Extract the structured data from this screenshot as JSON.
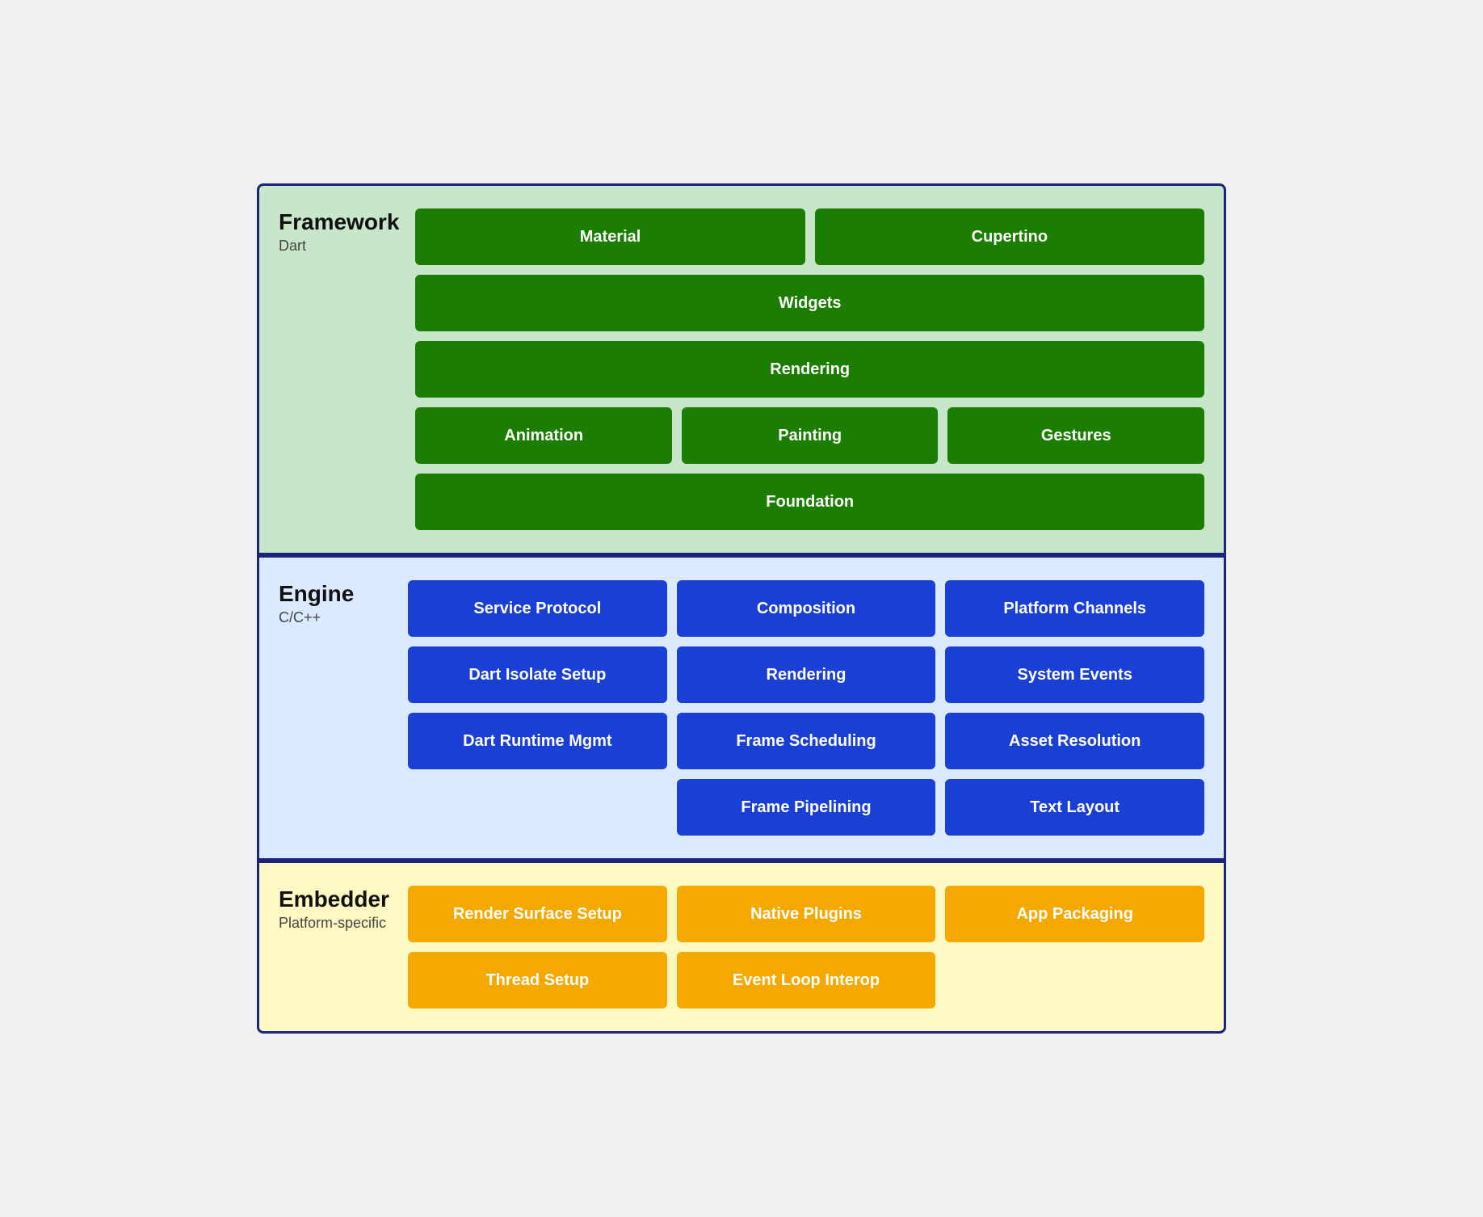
{
  "framework": {
    "title": "Framework",
    "subtitle": "Dart",
    "rows": [
      [
        {
          "label": "Material",
          "span": 1
        },
        {
          "label": "Cupertino",
          "span": 1
        }
      ],
      [
        {
          "label": "Widgets",
          "span": 2
        }
      ],
      [
        {
          "label": "Rendering",
          "span": 2
        }
      ],
      [
        {
          "label": "Animation",
          "span": 1
        },
        {
          "label": "Painting",
          "span": 1
        },
        {
          "label": "Gestures",
          "span": 1
        }
      ],
      [
        {
          "label": "Foundation",
          "span": 3
        }
      ]
    ]
  },
  "engine": {
    "title": "Engine",
    "subtitle": "C/C++",
    "rows": [
      [
        {
          "label": "Service Protocol",
          "span": 1
        },
        {
          "label": "Composition",
          "span": 1
        },
        {
          "label": "Platform Channels",
          "span": 1
        }
      ],
      [
        {
          "label": "Dart Isolate Setup",
          "span": 1
        },
        {
          "label": "Rendering",
          "span": 1
        },
        {
          "label": "System Events",
          "span": 1
        }
      ],
      [
        {
          "label": "Dart Runtime Mgmt",
          "span": 1
        },
        {
          "label": "Frame Scheduling",
          "span": 1
        },
        {
          "label": "Asset Resolution",
          "span": 1
        }
      ],
      [
        {
          "label": null,
          "span": 1
        },
        {
          "label": "Frame Pipelining",
          "span": 1
        },
        {
          "label": "Text Layout",
          "span": 1
        }
      ]
    ]
  },
  "embedder": {
    "title": "Embedder",
    "subtitle": "Platform-specific",
    "rows": [
      [
        {
          "label": "Render Surface Setup",
          "span": 1
        },
        {
          "label": "Native Plugins",
          "span": 1
        },
        {
          "label": "App Packaging",
          "span": 1
        }
      ],
      [
        {
          "label": "Thread Setup",
          "span": 1
        },
        {
          "label": "Event Loop Interop",
          "span": 1
        },
        {
          "label": null,
          "span": 1
        }
      ]
    ]
  }
}
